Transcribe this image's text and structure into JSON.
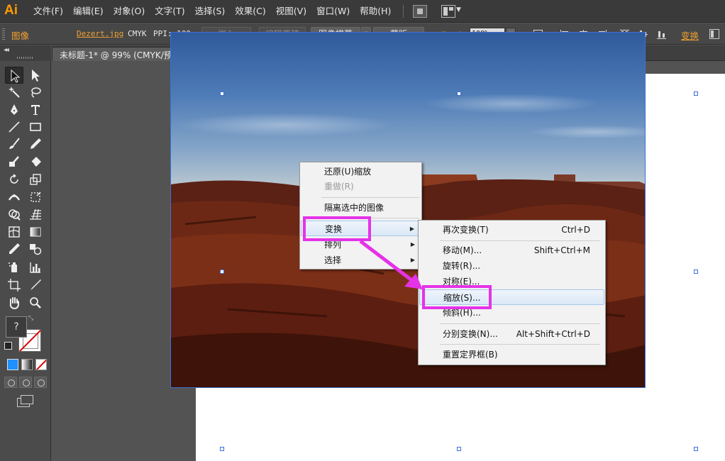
{
  "app": {
    "logo": "Ai"
  },
  "menubar": {
    "items": [
      "文件(F)",
      "编辑(E)",
      "对象(O)",
      "文字(T)",
      "选择(S)",
      "效果(C)",
      "视图(V)",
      "窗口(W)",
      "帮助(H)"
    ]
  },
  "controlbar": {
    "object_type": "图像",
    "filename": "Dezert.jpg",
    "color_mode": "CMYK",
    "ppi": "PPI: 109",
    "embed_label": "嵌入",
    "edit_original_label": "编辑原稿",
    "image_trace_label": "图像描摹",
    "mask_label": "蒙版",
    "opacity_label": "不透明度:",
    "opacity_value": "100%",
    "transform_label": "变换"
  },
  "document_tab": {
    "title": "未标题-1* @ 99% (CMYK/预览)",
    "close": "×"
  },
  "toolbox": {
    "fill_label": "?",
    "collapse": "◂◂"
  },
  "context_menu": {
    "items": [
      {
        "label": "还原(U)缩放",
        "disabled": false
      },
      {
        "label": "重做(R)",
        "disabled": true
      },
      {
        "label": "隔离选中的图像",
        "disabled": false
      },
      {
        "label": "变换",
        "has_submenu": true
      },
      {
        "label": "排列",
        "has_submenu": true
      },
      {
        "label": "选择",
        "has_submenu": true
      }
    ]
  },
  "transform_submenu": {
    "items": [
      {
        "label": "再次变换(T)",
        "shortcut": "Ctrl+D"
      },
      {
        "label": "移动(M)...",
        "shortcut": "Shift+Ctrl+M"
      },
      {
        "label": "旋转(R)...",
        "shortcut": ""
      },
      {
        "label": "对称(E)...",
        "shortcut": ""
      },
      {
        "label": "缩放(S)...",
        "shortcut": ""
      },
      {
        "label": "倾斜(H)...",
        "shortcut": ""
      },
      {
        "label": "分别变换(N)...",
        "shortcut": "Alt+Shift+Ctrl+D"
      },
      {
        "label": "重置定界框(B)",
        "shortcut": ""
      }
    ]
  },
  "colors": {
    "accent_orange": "#f0a030",
    "annotation_magenta": "#e532e8",
    "selection_blue": "#3d6fd6"
  },
  "icons": {
    "tools": [
      "selection-tool-icon",
      "direct-selection-tool-icon",
      "magic-wand-tool-icon",
      "lasso-tool-icon",
      "pen-tool-icon",
      "type-tool-icon",
      "line-segment-tool-icon",
      "rectangle-tool-icon",
      "paintbrush-tool-icon",
      "pencil-tool-icon",
      "blob-brush-tool-icon",
      "eraser-tool-icon",
      "rotate-tool-icon",
      "scale-tool-icon",
      "width-tool-icon",
      "free-transform-tool-icon",
      "shape-builder-tool-icon",
      "perspective-grid-tool-icon",
      "mesh-tool-icon",
      "gradient-tool-icon",
      "eyedropper-tool-icon",
      "blend-tool-icon",
      "symbol-sprayer-tool-icon",
      "column-graph-tool-icon",
      "artboard-tool-icon",
      "slice-tool-icon",
      "hand-tool-icon",
      "zoom-tool-icon"
    ]
  }
}
